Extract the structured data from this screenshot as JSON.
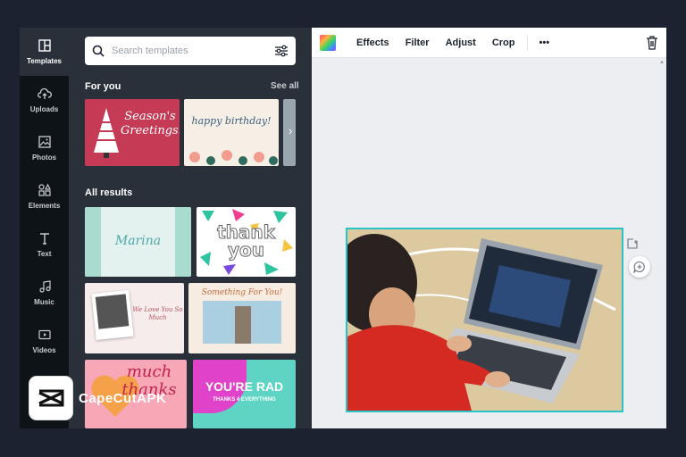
{
  "rail": {
    "items": [
      {
        "label": "Templates",
        "icon": "templates-icon"
      },
      {
        "label": "Uploads",
        "icon": "upload-cloud-icon"
      },
      {
        "label": "Photos",
        "icon": "image-icon"
      },
      {
        "label": "Elements",
        "icon": "shapes-icon"
      },
      {
        "label": "Text",
        "icon": "text-t-icon"
      },
      {
        "label": "Music",
        "icon": "music-note-icon"
      },
      {
        "label": "Videos",
        "icon": "video-play-icon"
      }
    ]
  },
  "panel": {
    "search_placeholder": "Search templates",
    "for_you": "For you",
    "see_all": "See all",
    "all_results": "All results",
    "templates": {
      "seasons": "Season's Greetings!",
      "birthday": "happy birthday!",
      "marina": "Marina",
      "thank_you": "thank you",
      "love_you": "We Love You So Much",
      "something": "Something For You!",
      "much_thanks": "much thanks",
      "youre_rad": "YOU'RE RAD",
      "rad_sub": "THANKS 4 EVERYTHING"
    }
  },
  "toolbar": {
    "effects": "Effects",
    "filter": "Filter",
    "adjust": "Adjust",
    "crop": "Crop",
    "more": "•••"
  },
  "watermark": {
    "text": "CapeCutAPK"
  },
  "colors": {
    "accent": "#29c3c8",
    "panel_bg": "#293039",
    "rail_bg": "#0e1318"
  }
}
